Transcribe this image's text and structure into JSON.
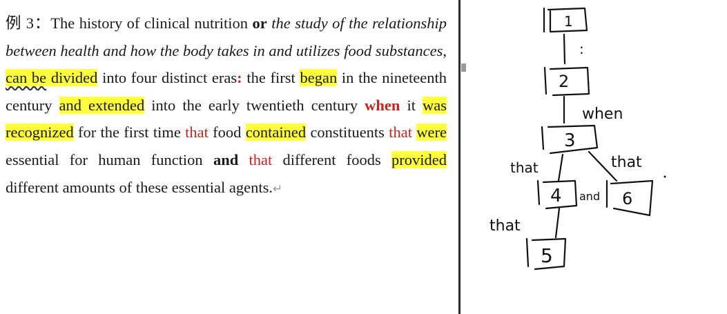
{
  "document": {
    "example_label": "例 3：",
    "segments": [
      {
        "text": "The history of clinical nutrition ",
        "style": "plain"
      },
      {
        "text": "or",
        "style": "bold"
      },
      {
        "text": " ",
        "style": "plain"
      },
      {
        "text": "the study of the relationship between health and how the body takes in and utilizes food substances",
        "style": "italic"
      },
      {
        "text": ", ",
        "style": "plain"
      },
      {
        "text": "can be divided",
        "style": "highlight"
      },
      {
        "text": " into four distinct eras",
        "style": "plain"
      },
      {
        "text": ":",
        "style": "red-bold"
      },
      {
        "text": " the first ",
        "style": "plain"
      },
      {
        "text": "began",
        "style": "highlight"
      },
      {
        "text": " in the nineteenth century ",
        "style": "plain"
      },
      {
        "text": "and extended",
        "style": "highlight"
      },
      {
        "text": " into the early twentieth century ",
        "style": "plain"
      },
      {
        "text": "when",
        "style": "red-bold"
      },
      {
        "text": " it ",
        "style": "plain"
      },
      {
        "text": "was recognized",
        "style": "highlight"
      },
      {
        "text": " for the first time ",
        "style": "plain"
      },
      {
        "text": "that",
        "style": "red"
      },
      {
        "text": " food ",
        "style": "plain"
      },
      {
        "text": "contained",
        "style": "highlight"
      },
      {
        "text": " constituents ",
        "style": "plain"
      },
      {
        "text": "that",
        "style": "red"
      },
      {
        "text": " ",
        "style": "plain"
      },
      {
        "text": "were essential",
        "style": "highlight-partial"
      },
      {
        "text": " for human function ",
        "style": "plain"
      },
      {
        "text": "and",
        "style": "bold"
      },
      {
        "text": " ",
        "style": "plain"
      },
      {
        "text": "that",
        "style": "red"
      },
      {
        "text": " different foods ",
        "style": "plain"
      },
      {
        "text": "provided",
        "style": "highlight"
      },
      {
        "text": " different amounts of these essential agents.",
        "style": "plain"
      }
    ],
    "paragraph_mark": "↵",
    "colors": {
      "highlight": "#ffff3b",
      "red": "#c8231f",
      "text": "#1a1a1a"
    }
  },
  "whiteboard": {
    "boxes": [
      "1",
      "2",
      "3",
      "4",
      "5",
      "6"
    ],
    "labels": {
      "colon": ":",
      "when": "when",
      "that_left": "that",
      "that_right": "that",
      "and": "and",
      "that_lower": "that"
    },
    "ink_color": "#111111"
  }
}
